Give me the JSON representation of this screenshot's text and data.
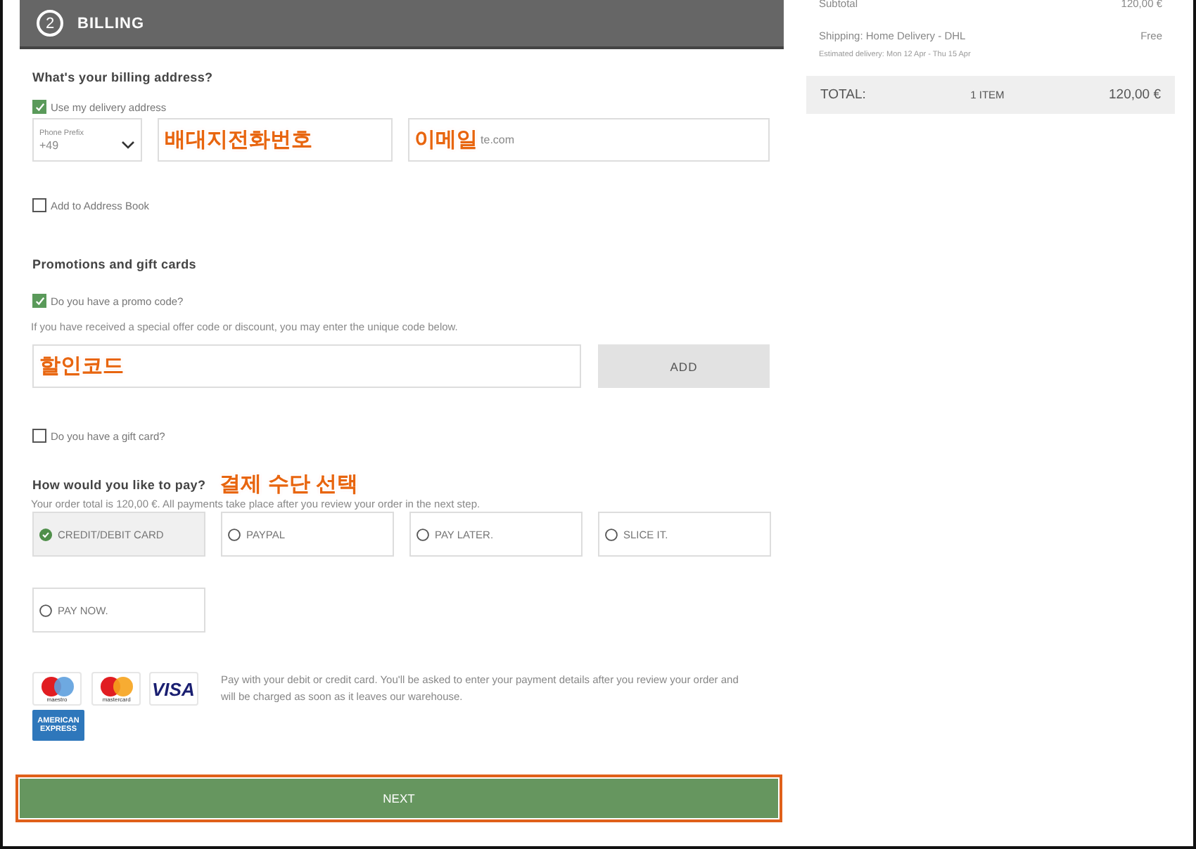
{
  "step": {
    "number": "2",
    "title": "BILLING"
  },
  "billing": {
    "heading": "What's your billing address?",
    "use_delivery": {
      "label": "Use my delivery address",
      "checked": true
    },
    "phone_prefix": {
      "label": "Phone Prefix",
      "value": "+49"
    },
    "phone_field": {
      "annotation": "배대지전화번호"
    },
    "email_field": {
      "annotation": "이메일",
      "value": "te.com"
    },
    "add_to_address_book": {
      "label": "Add to Address Book",
      "checked": false
    }
  },
  "promotions": {
    "heading": "Promotions and gift cards",
    "promo": {
      "label": "Do you have a promo code?",
      "checked": true
    },
    "hint": "If you have received a special offer code or discount, you may enter the unique code below.",
    "code_field": {
      "annotation": "할인코드"
    },
    "add_button": "ADD",
    "gift": {
      "label": "Do you have a gift card?",
      "checked": false
    }
  },
  "payment": {
    "heading": "How would you like to pay?",
    "annotation": "결제 수단 선택",
    "note": "Your order total is 120,00 €. All payments take place after you review your order in the next step.",
    "methods": [
      {
        "label": "CREDIT/DEBIT CARD",
        "selected": true
      },
      {
        "label": "PAYPAL",
        "selected": false
      },
      {
        "label": "PAY LATER.",
        "selected": false
      },
      {
        "label": "SLICE IT.",
        "selected": false
      },
      {
        "label": "PAY NOW.",
        "selected": false
      }
    ],
    "cards": [
      {
        "kind": "maestro",
        "label": "maestro"
      },
      {
        "kind": "mastercard",
        "label": "mastercard"
      },
      {
        "kind": "visa",
        "label": "VISA"
      },
      {
        "kind": "amex",
        "label": "AMERICAN EXPRESS"
      }
    ],
    "description": "Pay with your debit or credit card. You'll be asked to enter your payment details after you review your order and will be charged as soon as it leaves our warehouse."
  },
  "next_button": "NEXT",
  "summary": {
    "subtotal_label": "Subtotal",
    "subtotal_value": "120,00 €",
    "shipping_label": "Shipping: Home Delivery - DHL",
    "shipping_value": "Free",
    "estimate": "Estimated delivery: Mon 12 Apr - Thu 15 Apr",
    "total_label": "TOTAL:",
    "total_items": "1 ITEM",
    "total_value": "120,00 €"
  }
}
